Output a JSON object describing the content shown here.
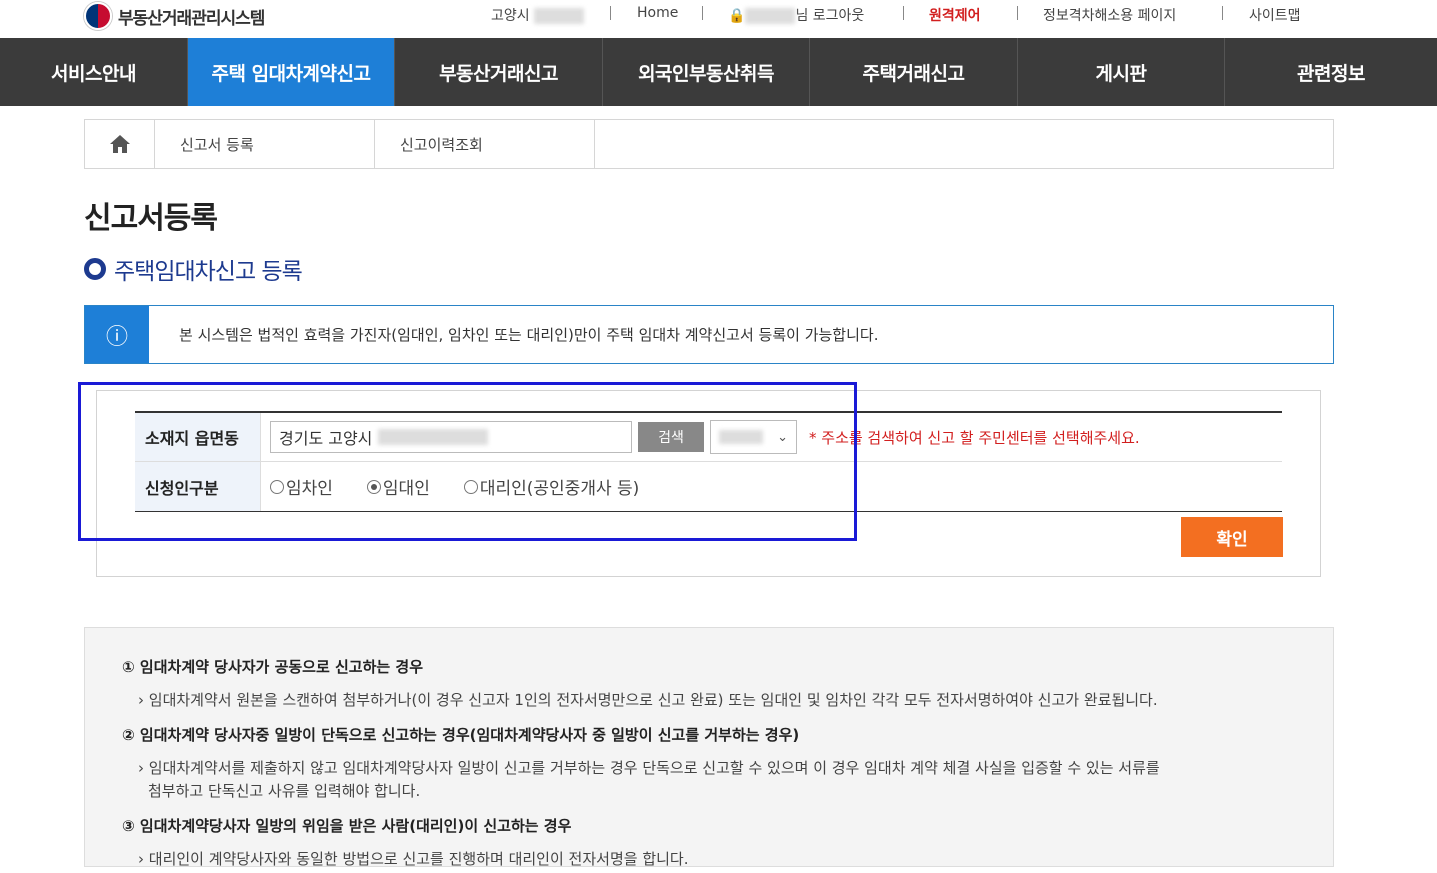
{
  "header": {
    "logo_text": "부동산거래관리시스템",
    "region": "고양시",
    "home": "Home",
    "logout": "님 로그아웃",
    "remote": "원격제어",
    "accessibility": "정보격차해소용 페이지",
    "sitemap": "사이트맵"
  },
  "nav": {
    "items": [
      {
        "label": "서비스안내"
      },
      {
        "label": "주택 임대차계약신고"
      },
      {
        "label": "부동산거래신고"
      },
      {
        "label": "외국인부동산취득"
      },
      {
        "label": "주택거래신고"
      },
      {
        "label": "게시판"
      },
      {
        "label": "관련정보"
      }
    ],
    "active_index": 1
  },
  "breadcrumb": {
    "items": [
      "신고서 등록",
      "신고이력조회"
    ]
  },
  "page": {
    "title": "신고서등록",
    "subtitle": "주택임대차신고 등록"
  },
  "notice": {
    "icon": "info-icon",
    "text": "본 시스템은 법적인 효력을 가진자(임대인, 임차인 또는 대리인)만이 주택 임대차 계약신고서 등록이 가능합니다."
  },
  "form": {
    "location_label": "소재지 읍면동",
    "address_value": "경기도 고양시",
    "search_button": "검색",
    "hint": "* 주소를 검색하여 신고 할 주민센터를 선택해주세요.",
    "applicant_label": "신청인구분",
    "options": [
      "임차인",
      "임대인",
      "대리인(공인중개사 등)"
    ],
    "selected_option": "임대인",
    "confirm_button": "확인"
  },
  "guide": {
    "h1": "① 임대차계약 당사자가 공동으로 신고하는 경우",
    "p1": "› 임대차계약서 원본을 스캔하여 첨부하거나(이 경우 신고자 1인의 전자서명만으로 신고 완료) 또는 임대인 및 임차인 각각 모두 전자서명하여야 신고가 완료됩니다.",
    "h2": "② 임대차계약 당사자중 일방이 단독으로 신고하는 경우(임대차계약당사자 중 일방이 신고를 거부하는 경우)",
    "p2a": "› 임대차계약서를 제출하지 않고 임대차계약당사자 일방이 신고를 거부하는 경우 단독으로 신고할 수 있으며 이 경우 임대차 계약 체결 사실을 입증할 수 있는 서류를",
    "p2b": "첨부하고 단독신고 사유를 입력해야 합니다.",
    "h3": "③ 임대차계약당사자 일방의 위임을 받은 사람(대리인)이 신고하는 경우",
    "p3": "› 대리인이 계약당사자와 동일한 방법으로 신고를 진행하며 대리인이 전자서명을 합니다."
  },
  "colors": {
    "nav_bg": "#3b3b3b",
    "nav_active": "#1e7fd7",
    "accent_orange": "#f36f21",
    "title_blue": "#1d3a8f",
    "highlight": "#1a1ad6"
  }
}
